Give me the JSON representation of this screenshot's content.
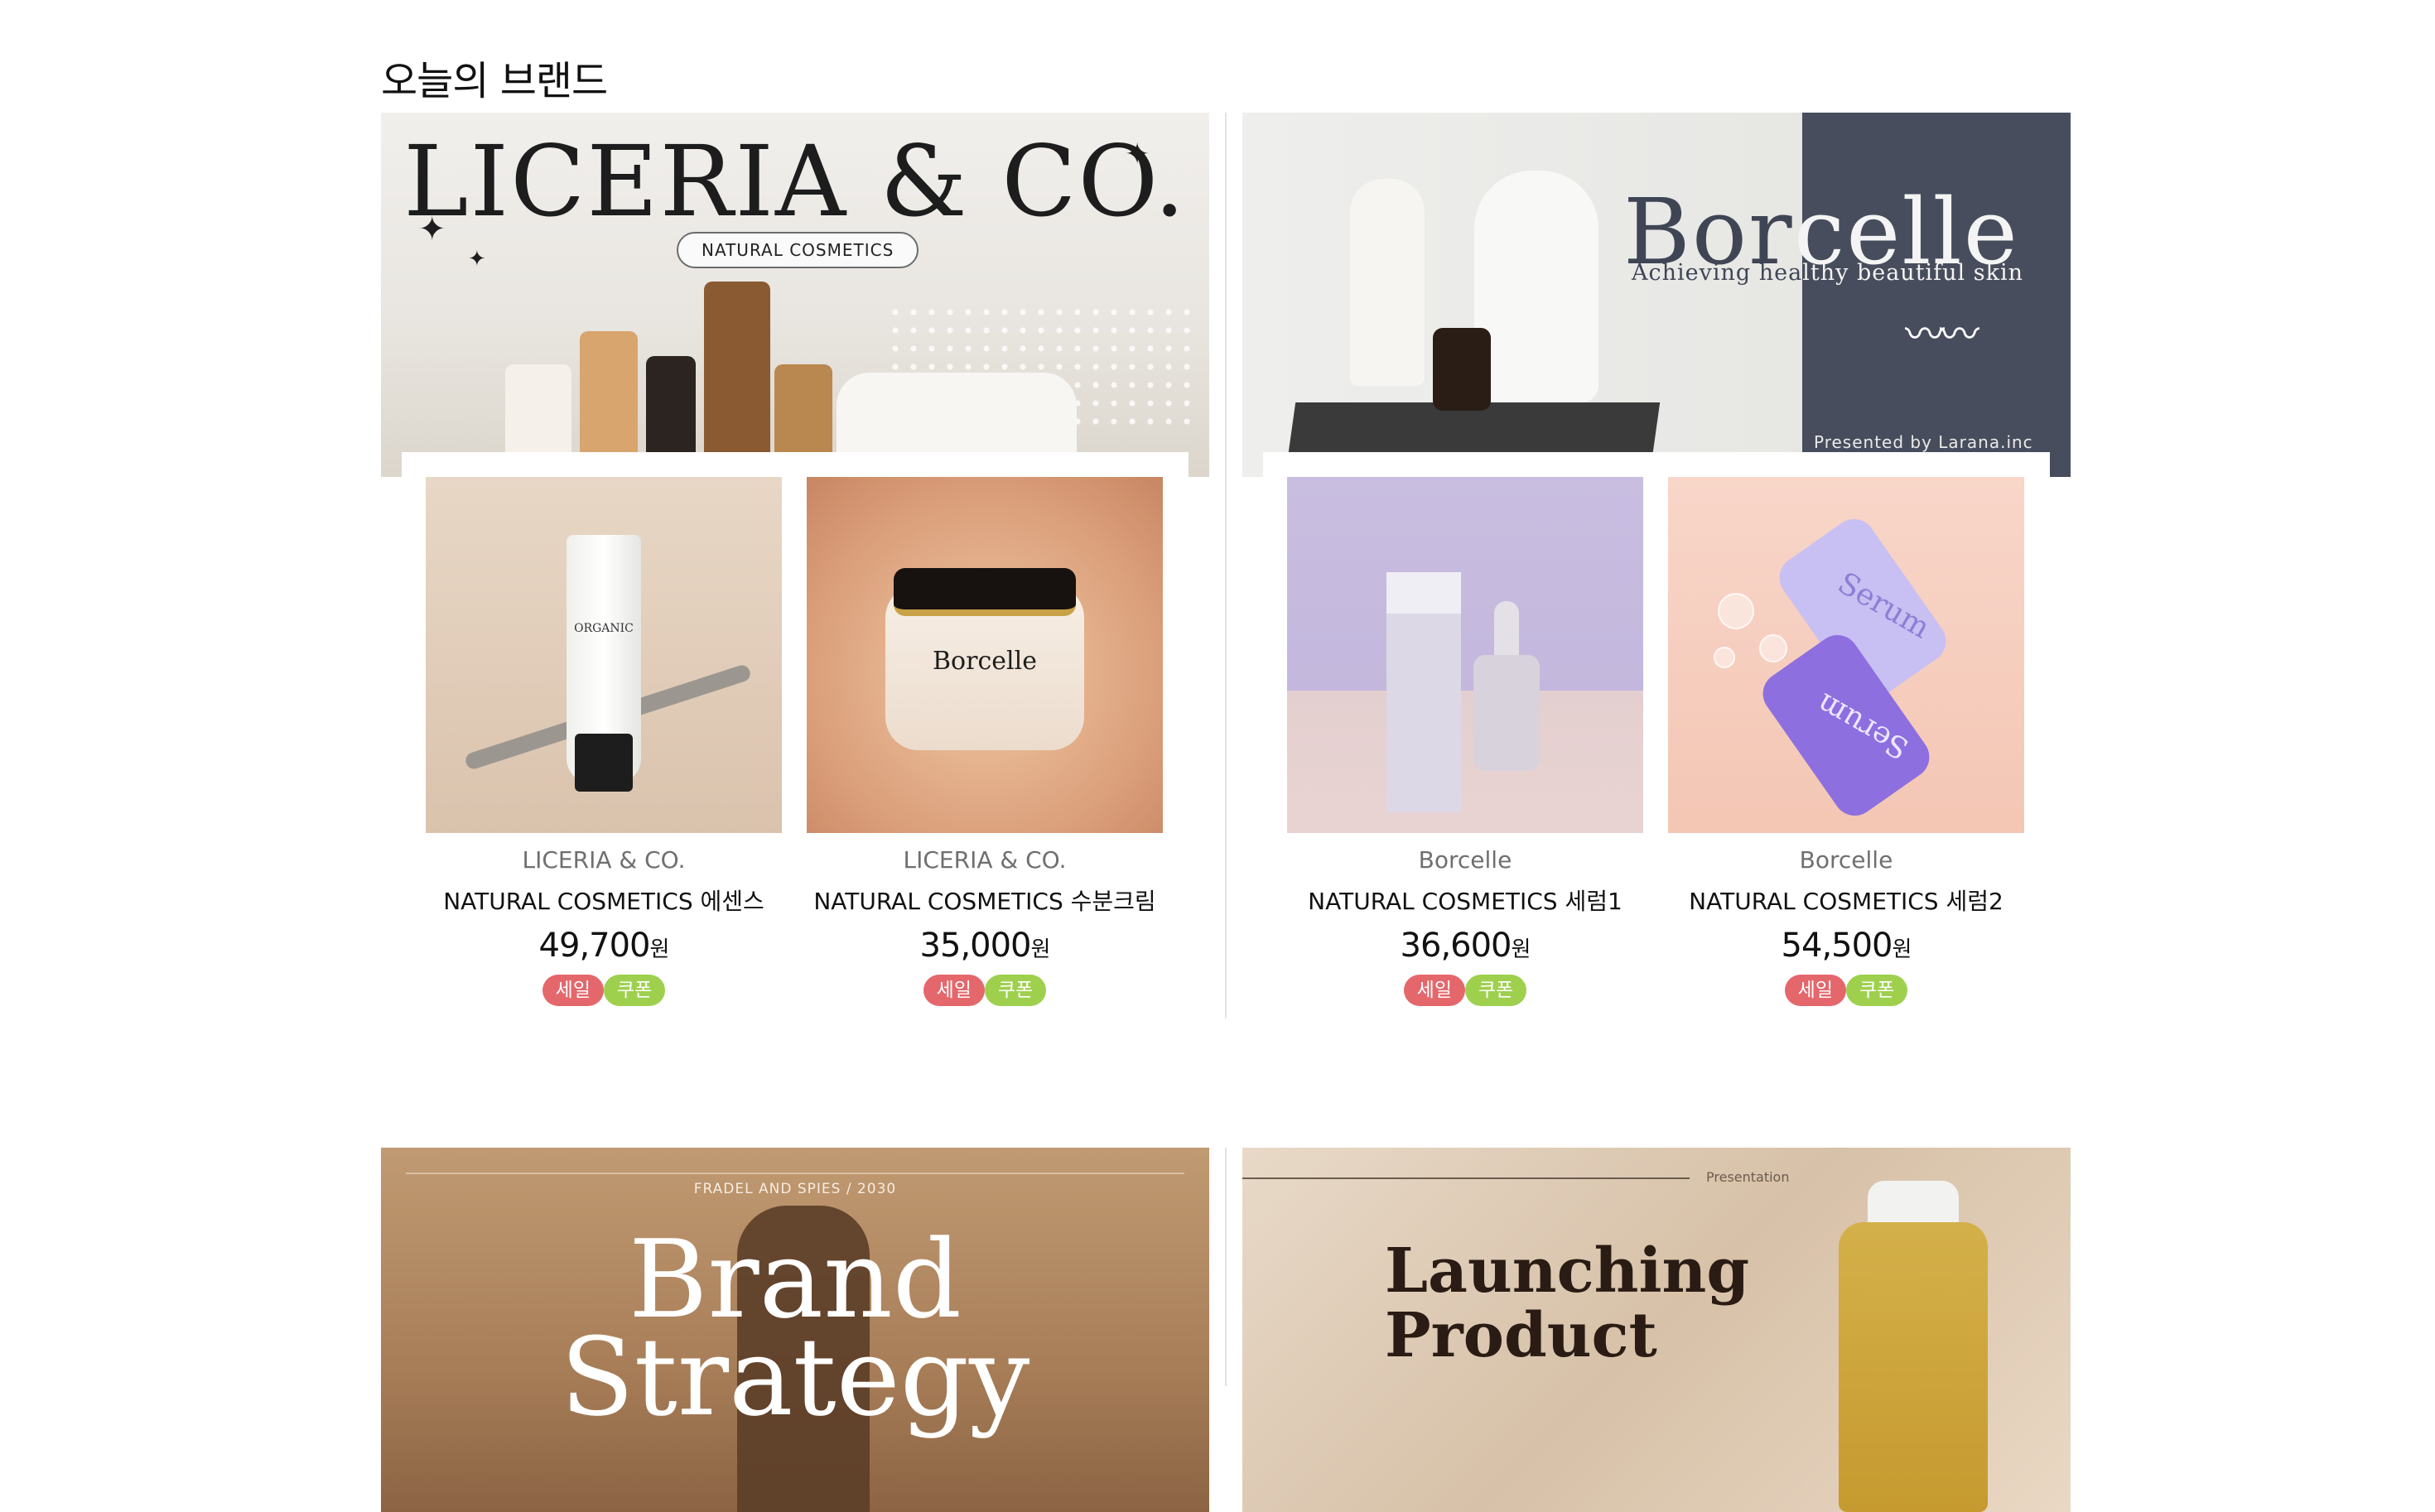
{
  "section": {
    "title": "오늘의 브랜드"
  },
  "banners": {
    "b1": {
      "title": "LICERIA & CO.",
      "pill": "NATURAL COSMETICS",
      "stars": [
        "✦",
        "✦",
        "✦"
      ]
    },
    "b2": {
      "title_dark": "Bor",
      "title_light": "celle",
      "subtitle_dark": "Achieving hea",
      "subtitle_light": "lthy beautiful skin",
      "presented": "Presented by Larana.inc",
      "waves": "〰〰"
    },
    "b3": {
      "kicker": "FRADEL AND SPIES / 2030",
      "title_line1": "Brand",
      "title_line2": "Strategy"
    },
    "b4": {
      "presentation": "Presentation",
      "title_line1": "Launching",
      "title_line2": "Product"
    }
  },
  "products": [
    {
      "brand": "LICERIA & CO.",
      "name": "NATURAL COSMETICS 에센스",
      "price": "49,700",
      "unit": "원",
      "tag_sale": "세일",
      "tag_coupon": "쿠폰",
      "image_label": "ORGANIC"
    },
    {
      "brand": "LICERIA & CO.",
      "name": "NATURAL COSMETICS 수분크림",
      "price": "35,000",
      "unit": "원",
      "tag_sale": "세일",
      "tag_coupon": "쿠폰",
      "image_label": "Borcelle"
    },
    {
      "brand": "Borcelle",
      "name": "NATURAL COSMETICS 세럼1",
      "price": "36,600",
      "unit": "원",
      "tag_sale": "세일",
      "tag_coupon": "쿠폰"
    },
    {
      "brand": "Borcelle",
      "name": "NATURAL COSMETICS 세럼2",
      "price": "54,500",
      "unit": "원",
      "tag_sale": "세일",
      "tag_coupon": "쿠폰",
      "image_label": "Serum"
    }
  ],
  "colors": {
    "sale": "#e4676c",
    "coupon": "#9ed04e",
    "banner_panel": "#474d5c"
  }
}
